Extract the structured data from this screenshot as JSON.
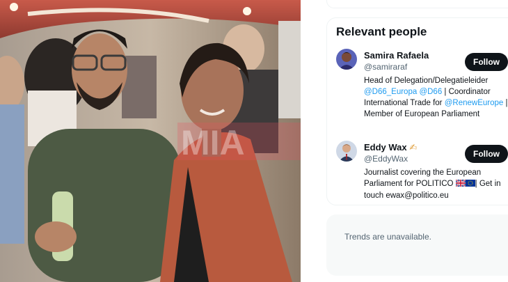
{
  "sidebar": {
    "people_title": "Relevant people",
    "people": [
      {
        "name": "Samira Rafaela",
        "handle": "@samiraraf",
        "follow_label": "Follow",
        "bio": {
          "t1": "Head of Delegation/Delegatieleider",
          "l1": "@D66_Europa",
          "l2": "@D66",
          "t2": " | Coordinator International Trade for ",
          "l3": "@RenewEurope",
          "t3": " | Member of European Parliament"
        }
      },
      {
        "name": "Eddy Wax",
        "name_emoji": "✍",
        "handle": "@EddyWax",
        "follow_label": "Follow",
        "bio": {
          "t1": "Journalist covering the European Parliament for POLITICO ",
          "t2": "| Get in touch ewax@politico.eu"
        }
      }
    ],
    "trends_text": "Trends are unavailable."
  },
  "photo": {
    "watermark": "MIA"
  }
}
